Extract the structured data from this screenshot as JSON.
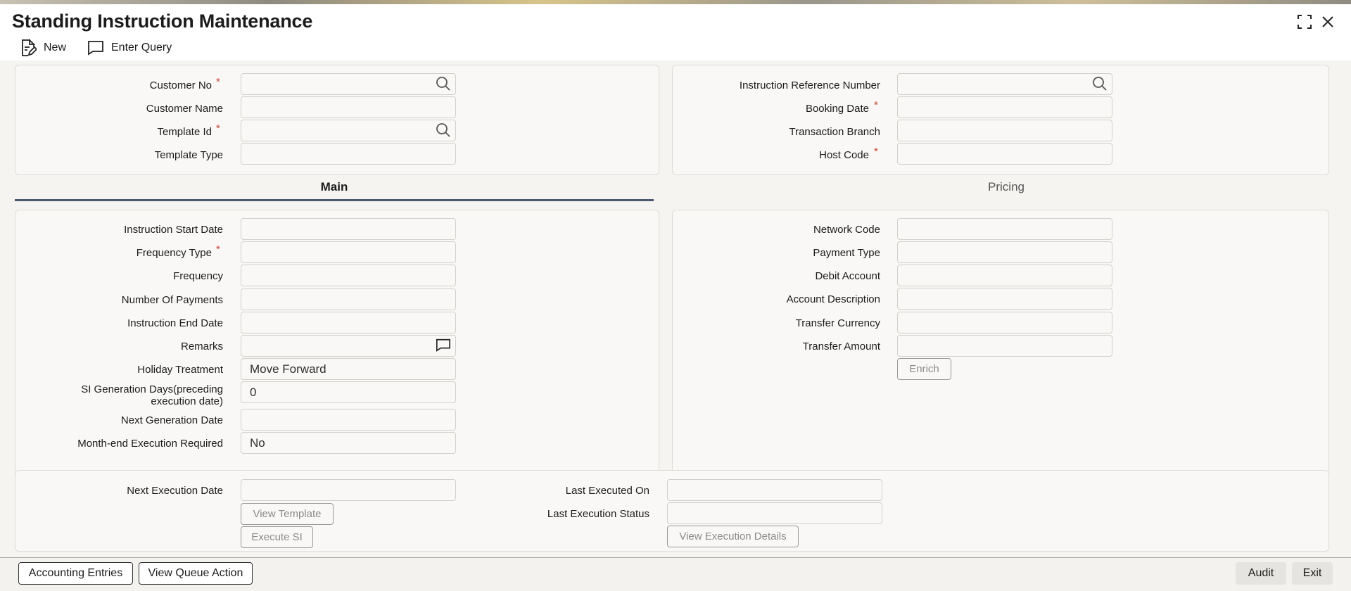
{
  "window": {
    "title": "Standing Instruction Maintenance",
    "maximize_icon": "maximize-icon",
    "close_icon": "close-icon"
  },
  "toolbar": {
    "new_label": "New",
    "enter_query_label": "Enter Query"
  },
  "header_left": {
    "customer_no": {
      "label": "Customer No",
      "value": ""
    },
    "customer_name": {
      "label": "Customer Name",
      "value": ""
    },
    "template_id": {
      "label": "Template Id",
      "value": ""
    },
    "template_type": {
      "label": "Template Type",
      "value": ""
    }
  },
  "header_right": {
    "instruction_reference_number": {
      "label": "Instruction Reference Number",
      "value": ""
    },
    "booking_date": {
      "label": "Booking Date",
      "value": ""
    },
    "transaction_branch": {
      "label": "Transaction Branch",
      "value": ""
    },
    "host_code": {
      "label": "Host Code",
      "value": ""
    }
  },
  "tabs": [
    {
      "label": "Main",
      "active": true
    },
    {
      "label": "Pricing",
      "active": false
    }
  ],
  "main_left": {
    "instruction_start_date": {
      "label": "Instruction Start Date",
      "value": ""
    },
    "frequency_type": {
      "label": "Frequency Type",
      "value": ""
    },
    "frequency": {
      "label": "Frequency",
      "value": ""
    },
    "number_of_payments": {
      "label": "Number Of Payments",
      "value": ""
    },
    "instruction_end_date": {
      "label": "Instruction End Date",
      "value": ""
    },
    "remarks": {
      "label": "Remarks",
      "value": ""
    },
    "holiday_treatment": {
      "label": "Holiday Treatment",
      "value": "Move Forward"
    },
    "si_generation_days": {
      "label_line1": "SI Generation Days(preceding",
      "label_line2": "execution date)",
      "value": "0"
    },
    "next_generation_date": {
      "label": "Next Generation Date",
      "value": ""
    },
    "month_end_execution": {
      "label": "Month-end Execution Required",
      "value": "No"
    }
  },
  "main_right": {
    "network_code": {
      "label": "Network Code",
      "value": ""
    },
    "payment_type": {
      "label": "Payment Type",
      "value": ""
    },
    "debit_account": {
      "label": "Debit Account",
      "value": ""
    },
    "account_description": {
      "label": "Account Description",
      "value": ""
    },
    "transfer_currency": {
      "label": "Transfer Currency",
      "value": ""
    },
    "transfer_amount": {
      "label": "Transfer Amount",
      "value": ""
    },
    "enrich_label": "Enrich"
  },
  "execution": {
    "next_execution_date": {
      "label": "Next Execution Date",
      "value": ""
    },
    "last_executed_on": {
      "label": "Last Executed On",
      "value": ""
    },
    "last_execution_status": {
      "label": "Last Execution Status",
      "value": ""
    },
    "view_template_label": "View Template",
    "execute_si_label": "Execute SI",
    "view_execution_details_label": "View Execution Details"
  },
  "footer": {
    "accounting_entries_label": "Accounting Entries",
    "view_queue_action_label": "View Queue Action",
    "audit_label": "Audit",
    "exit_label": "Exit"
  },
  "colors": {
    "required_asterisk": "#c74634",
    "tab_active_underline": "#4a5873",
    "panel_background": "#f9f8f6"
  }
}
